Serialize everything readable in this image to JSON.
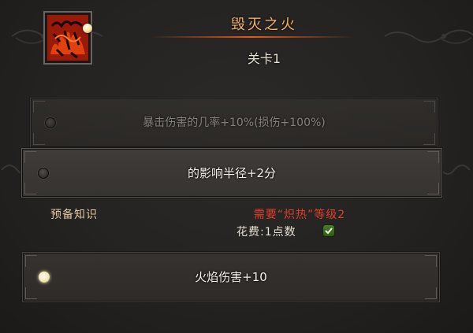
{
  "skill": {
    "title": "毁灭之火",
    "subtitle": "关卡1",
    "icon": "fire-rune-icon"
  },
  "options": [
    {
      "label": "暴击伤害的几率+10%(损伤+100%)",
      "state": "dimmed"
    },
    {
      "label": "的影响半径+2分",
      "state": "highlighted"
    }
  ],
  "prerequisites": {
    "label": "预备知识",
    "requirement": "需要“炽热”等级2",
    "cost": "花费:1点数",
    "cost_met_icon": "checkmark-icon"
  },
  "selected_option": {
    "label": "火焰伤害+10",
    "state": "selected"
  },
  "colors": {
    "title": "#f3b06e",
    "requirement": "#e03f2b",
    "prereq_label": "#e0c9a0",
    "check": "#4c7a2e"
  }
}
